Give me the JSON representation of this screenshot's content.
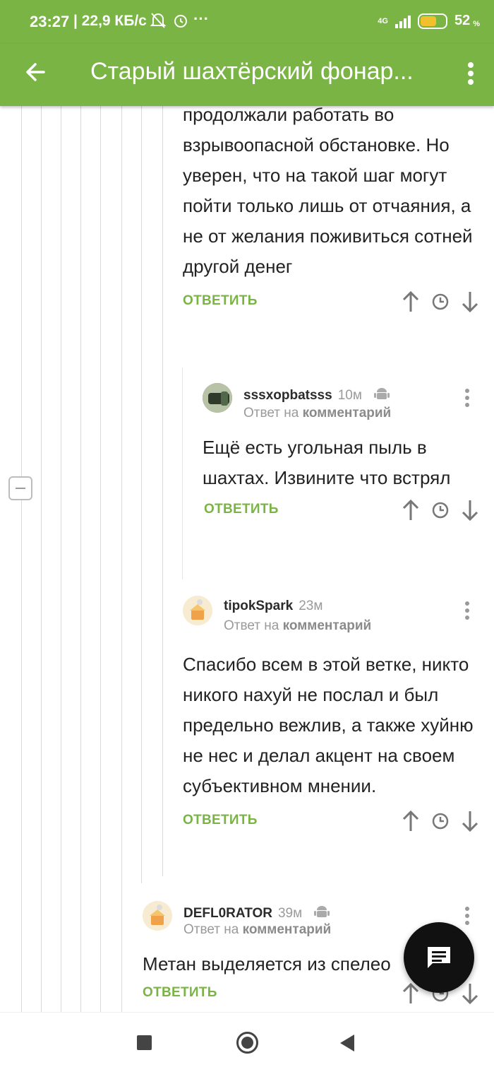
{
  "status_bar": {
    "time": "23:27",
    "info": "| 22,9 КБ/с",
    "network": "4G",
    "battery": "52",
    "battery_unit": "%",
    "battery_level_percent": 52
  },
  "app_bar": {
    "title": "Старый шахтёрский фонар..."
  },
  "comments": [
    {
      "text": "продолжали работать во взрывоопасной обстановке. Но уверен, что на такой шаг могут пойти только лишь от отчаяния, а не от желания поживиться сотней другой денег",
      "reply_label": "ОТВЕТИТЬ"
    },
    {
      "user": "sssxopbatsss",
      "time": "10м",
      "reply_prefix": "Ответ на",
      "reply_target": "комментарий",
      "text": "Ещё есть угольная пыль в шахтах. Извините что встрял",
      "reply_label": "ОТВЕТИТЬ"
    },
    {
      "user": "tipokSpark",
      "time": "23м",
      "reply_prefix": "Ответ на",
      "reply_target": "комментарий",
      "text": "Спасибо всем в этой ветке, никто никого нахуй не послал и был предельно вежлив, а также хуйню не нес и делал акцент на своем субъективном мнении.",
      "reply_label": "ОТВЕТИТЬ"
    },
    {
      "user": "DEFL0RATOR",
      "time": "39м",
      "reply_prefix": "Ответ на",
      "reply_target": "комментарий",
      "text": "Метан выделяется из спелео",
      "reply_label": "ОТВЕТИТЬ"
    }
  ],
  "icons": {
    "back": "arrow-left-icon",
    "more": "kebab-menu-icon",
    "upvote": "arrow-up-icon",
    "history": "clock-icon",
    "downvote": "arrow-down-icon",
    "platform": "android-icon",
    "fab": "comment-icon",
    "collapse": "minus-icon"
  },
  "colors": {
    "accent": "#79b445",
    "fab": "#111111"
  }
}
